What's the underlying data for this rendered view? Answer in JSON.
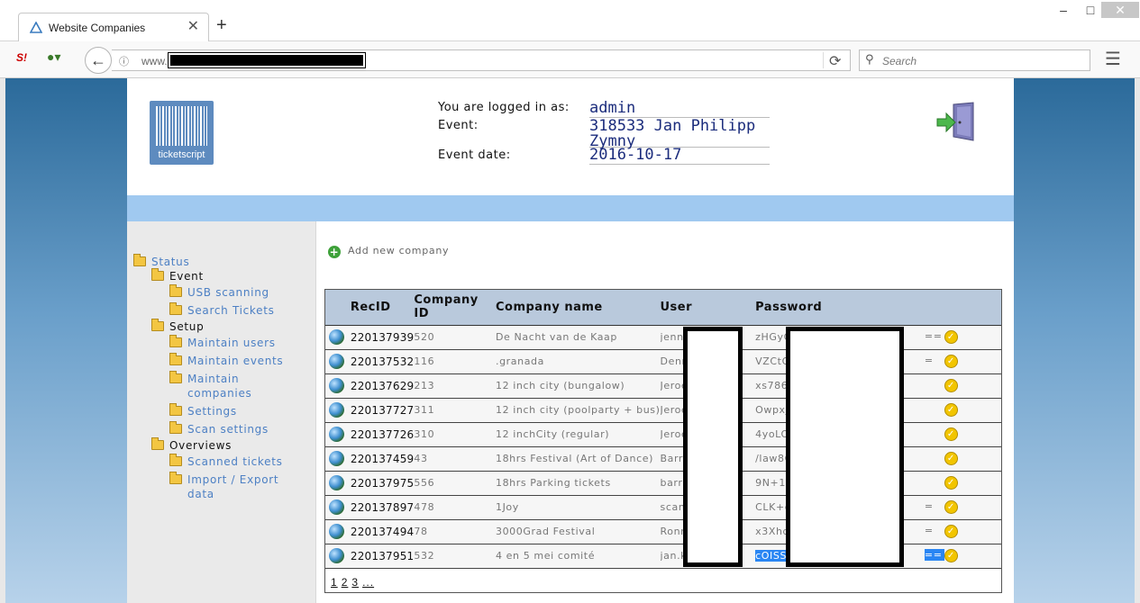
{
  "browser": {
    "tab_title": "Website Companies",
    "url_prefix": "www.",
    "search_placeholder": "Search",
    "new_tab": "+",
    "close_tab": "✕",
    "menu": "☰"
  },
  "header": {
    "logo_text": "ticketscript",
    "logged_in_label": "You are logged in as:",
    "logged_in_value": "admin",
    "event_label": "Event:",
    "event_value": "318533 Jan Philipp Zymny",
    "event_date_label": "Event date:",
    "event_date_value": "2016-10-17"
  },
  "sidebar": {
    "status": "Status",
    "event": "Event",
    "usb_scanning": "USB scanning",
    "search_tickets": "Search Tickets",
    "setup": "Setup",
    "maintain_users": "Maintain users",
    "maintain_events": "Maintain events",
    "maintain_companies_1": "Maintain",
    "maintain_companies_2": "companies",
    "settings": "Settings",
    "scan_settings": "Scan settings",
    "overviews": "Overviews",
    "scanned_tickets": "Scanned tickets",
    "import_export_1": "Import / Export",
    "import_export_2": "data"
  },
  "main": {
    "add_company": "Add new company",
    "columns": [
      "RecID",
      "Company ID",
      "Company name",
      "User",
      "Password"
    ],
    "rows": [
      {
        "recid": "220137939",
        "company_id": "520",
        "name": "De Nacht van de Kaap",
        "user": "jenni",
        "password": "zHGyC",
        "suffix": "=="
      },
      {
        "recid": "220137532",
        "company_id": "116",
        "name": ".granada",
        "user": "Denn",
        "password": "VZCtO",
        "suffix": "="
      },
      {
        "recid": "220137629",
        "company_id": "213",
        "name": "12 inch city (bungalow)",
        "user": "Jeroe",
        "password": "xs786",
        "suffix": ""
      },
      {
        "recid": "220137727",
        "company_id": "311",
        "name": "12 inch city (poolparty + bus)",
        "user": "Jeroe",
        "password": "Owpxj",
        "suffix": ""
      },
      {
        "recid": "220137726",
        "company_id": "310",
        "name": "12 inchCity (regular)",
        "user": "Jeroe",
        "password": "4yoLO",
        "suffix": ""
      },
      {
        "recid": "220137459",
        "company_id": "43",
        "name": "18hrs Festival (Art of Dance)",
        "user": "Barry",
        "password": "/law8C",
        "suffix": ""
      },
      {
        "recid": "220137975",
        "company_id": "556",
        "name": "18hrs Parking tickets",
        "user": "barry",
        "password": "9N+1T",
        "suffix": ""
      },
      {
        "recid": "220137897",
        "company_id": "478",
        "name": "1Joy",
        "user": "scan",
        "password": "CLK+c",
        "suffix": "="
      },
      {
        "recid": "220137494",
        "company_id": "78",
        "name": "3000Grad Festival",
        "user": "Ronn",
        "password": "x3Xhq",
        "suffix": "="
      },
      {
        "recid": "220137951",
        "company_id": "532",
        "name": "4 en 5 mei comité",
        "user": "jan.k",
        "password": "cOISS",
        "suffix": "=="
      }
    ],
    "pages": [
      "1",
      "2",
      "3",
      "..."
    ]
  },
  "colors": {
    "accent_band": "#a0c9f0",
    "link": "#4d80c4",
    "info_value": "#1b2c7c",
    "table_header": "#b9c9dc"
  }
}
